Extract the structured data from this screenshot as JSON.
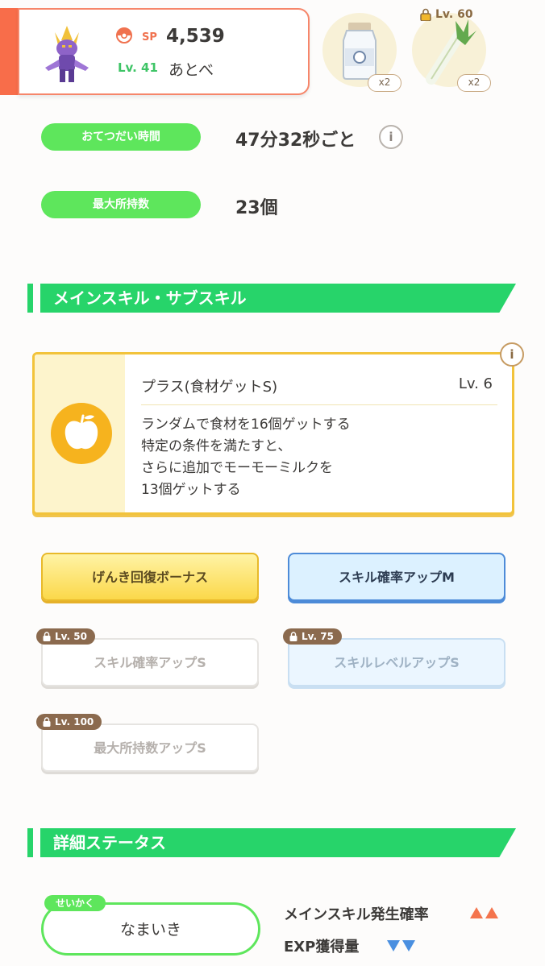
{
  "header": {
    "sp_label": "SP",
    "sp_value": "4,539",
    "level": "Lv. 41",
    "name": "あとべ",
    "accent": "#f86d4a"
  },
  "ingredients": [
    {
      "icon": "milk-bottle-icon",
      "count": "x2"
    },
    {
      "icon": "leek-icon",
      "count": "x2",
      "lock_level": "Lv. 60"
    }
  ],
  "stats": {
    "help_time_label": "おてつだい時間",
    "help_time_value": "47分32秒ごと",
    "max_carry_label": "最大所持数",
    "max_carry_value": "23個",
    "info_symbol": "i"
  },
  "skills_section": {
    "title": "メインスキル・サブスキル",
    "main_skill": {
      "title": "プラス(食材ゲットS)",
      "level": "Lv. 6",
      "desc": [
        "ランダムで食材を16個ゲットする",
        "特定の条件を満たすと、",
        "さらに追加でモーモーミルクを",
        "13個ゲットする"
      ],
      "info_symbol": "i",
      "icon": "apple-icon"
    },
    "sub_skills": [
      {
        "label": "げんき回復ボーナス",
        "locked": false,
        "style": "yellow"
      },
      {
        "label": "スキル確率アップM",
        "locked": false,
        "style": "blue"
      },
      {
        "label": "スキル確率アップS",
        "locked": true,
        "lock_level": "Lv. 50",
        "style": "white"
      },
      {
        "label": "スキルレベルアップS",
        "locked": true,
        "lock_level": "Lv. 75",
        "style": "blue"
      },
      {
        "label": "最大所持数アップS",
        "locked": true,
        "lock_level": "Lv. 100",
        "style": "white"
      }
    ]
  },
  "details_section": {
    "title": "詳細ステータス",
    "nature_tag": "せいかく",
    "nature": "なまいき",
    "up_stat": "メインスキル発生確率",
    "down_stat": "EXP獲得量",
    "up_color": "#f4744d",
    "down_color": "#4a8fe0"
  }
}
